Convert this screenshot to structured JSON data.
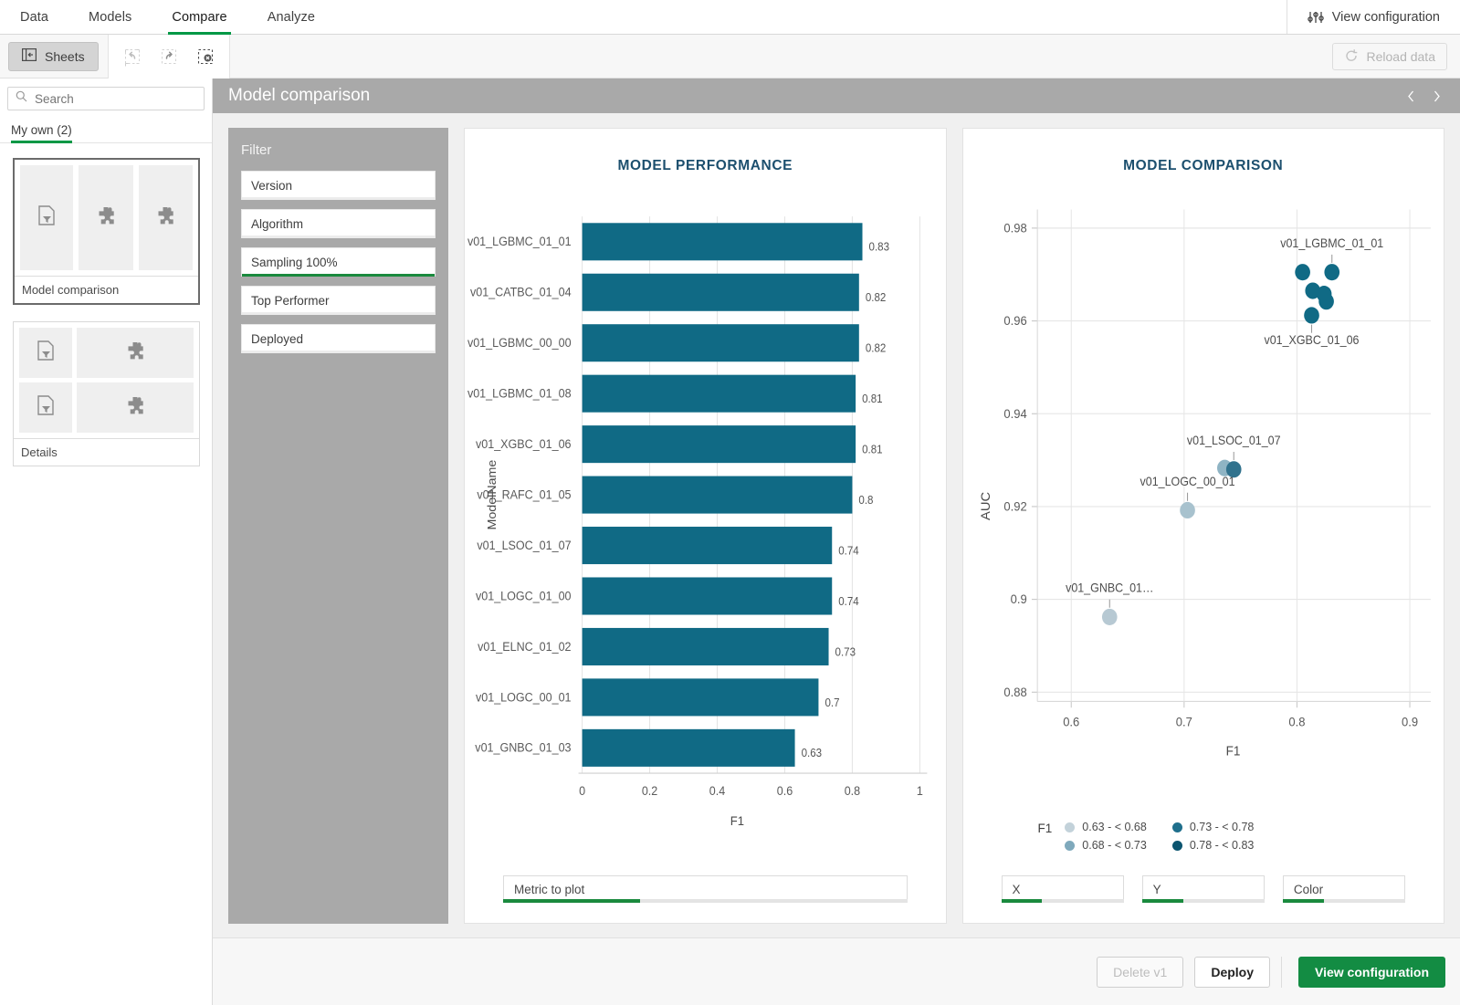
{
  "topnav": {
    "items": [
      {
        "label": "Data",
        "active": false
      },
      {
        "label": "Models",
        "active": false
      },
      {
        "label": "Compare",
        "active": true
      },
      {
        "label": "Analyze",
        "active": false
      }
    ],
    "view_configuration": "View configuration"
  },
  "toolbar": {
    "sheets_label": "Sheets",
    "reload_label": "Reload data"
  },
  "sidebar": {
    "search_placeholder": "Search",
    "tab_label": "My own (2)",
    "sheets": [
      {
        "name": "Model comparison",
        "selected": true
      },
      {
        "name": "Details",
        "selected": false
      }
    ]
  },
  "sheet": {
    "title": "Model comparison"
  },
  "filter": {
    "title": "Filter",
    "items": [
      {
        "label": "Version",
        "selected": false
      },
      {
        "label": "Algorithm",
        "selected": false
      },
      {
        "label": "Sampling 100%",
        "selected": true
      },
      {
        "label": "Top Performer",
        "selected": false
      },
      {
        "label": "Deployed",
        "selected": false
      }
    ]
  },
  "bar_controls": [
    {
      "label": "Metric to plot",
      "fill_pct": 22
    }
  ],
  "scatter_controls": [
    {
      "label": "X",
      "fill_pct": 28
    },
    {
      "label": "Y",
      "fill_pct": 28
    },
    {
      "label": "Color",
      "fill_pct": 28
    }
  ],
  "footer": {
    "delete_label": "Delete v1",
    "deploy_label": "Deploy",
    "view_configuration_label": "View configuration"
  },
  "colors": {
    "brand_green": "#009845",
    "bar_teal": "#106A85",
    "title_blue": "#1c4f6e",
    "header_gray": "#a9a9a9"
  },
  "chart_data": [
    {
      "type": "bar",
      "title": "MODEL PERFORMANCE",
      "orientation": "horizontal",
      "xlabel": "F1",
      "ylabel": "ModelName",
      "xlim": [
        0,
        1
      ],
      "xticks": [
        "0",
        "0.2",
        "0.4",
        "0.6",
        "0.8",
        "1"
      ],
      "grid": true,
      "bar_color": "#106A85",
      "categories": [
        "v01_LGBMC_01_01",
        "v01_CATBC_01_04",
        "v01_LGBMC_00_00",
        "v01_LGBMC_01_08",
        "v01_XGBC_01_06",
        "v01_RAFC_01_05",
        "v01_LSOC_01_07",
        "v01_LOGC_01_00",
        "v01_ELNC_01_02",
        "v01_LOGC_00_01",
        "v01_GNBC_01_03"
      ],
      "values": [
        0.83,
        0.82,
        0.82,
        0.81,
        0.81,
        0.8,
        0.74,
        0.74,
        0.73,
        0.7,
        0.63
      ],
      "value_labels": [
        "0.83",
        "0.82",
        "0.82",
        "0.81",
        "0.81",
        "0.8",
        "0.74",
        "0.74",
        "0.73",
        "0.7",
        "0.63"
      ]
    },
    {
      "type": "scatter",
      "title": "MODEL COMPARISON",
      "xlabel": "F1",
      "ylabel": "AUC",
      "xlim": [
        0.57,
        0.9
      ],
      "ylim": [
        0.878,
        0.98
      ],
      "xticks": [
        "0.6",
        "0.7",
        "0.8",
        "0.9"
      ],
      "xtick_values": [
        0.6,
        0.7,
        0.8,
        0.9
      ],
      "yticks": [
        "0.98",
        "0.96",
        "0.94",
        "0.92",
        "0.9",
        "0.88"
      ],
      "ytick_values": [
        0.98,
        0.96,
        0.94,
        0.92,
        0.9,
        0.88
      ],
      "grid": true,
      "points": [
        {
          "x": 0.805,
          "y": 0.9705,
          "color": "#106A85",
          "label": ""
        },
        {
          "x": 0.831,
          "y": 0.9705,
          "color": "#106A85",
          "label": "v01_LGBMC_01_01",
          "label_pos": "above"
        },
        {
          "x": 0.814,
          "y": 0.9665,
          "color": "#106A85",
          "label": ""
        },
        {
          "x": 0.824,
          "y": 0.9658,
          "color": "#106A85",
          "label": ""
        },
        {
          "x": 0.826,
          "y": 0.9642,
          "color": "#106A85",
          "label": ""
        },
        {
          "x": 0.813,
          "y": 0.9612,
          "color": "#106A85",
          "label": "v01_XGBC_01_06",
          "label_pos": "below"
        },
        {
          "x": 0.736,
          "y": 0.9283,
          "color": "#8FB4C4",
          "label": ""
        },
        {
          "x": 0.744,
          "y": 0.928,
          "color": "#31728D",
          "label": "v01_LSOC_01_07",
          "label_pos": "above"
        },
        {
          "x": 0.703,
          "y": 0.9192,
          "color": "#A8C2CE",
          "label": "v01_LOGC_00_01",
          "label_pos": "above"
        },
        {
          "x": 0.634,
          "y": 0.8962,
          "color": "#B7C9D3",
          "label": "v01_GNBC_01…",
          "label_pos": "above"
        }
      ],
      "legend": {
        "title": "F1",
        "position": "bottom",
        "entries": [
          {
            "label": "0.63 - < 0.68",
            "color": "#C3D2DA"
          },
          {
            "label": "0.73 - < 0.78",
            "color": "#1F6F8C"
          },
          {
            "label": "0.68 - < 0.73",
            "color": "#7FA9BC"
          },
          {
            "label": "0.78 - < 0.83",
            "color": "#0C5570"
          }
        ]
      }
    }
  ]
}
